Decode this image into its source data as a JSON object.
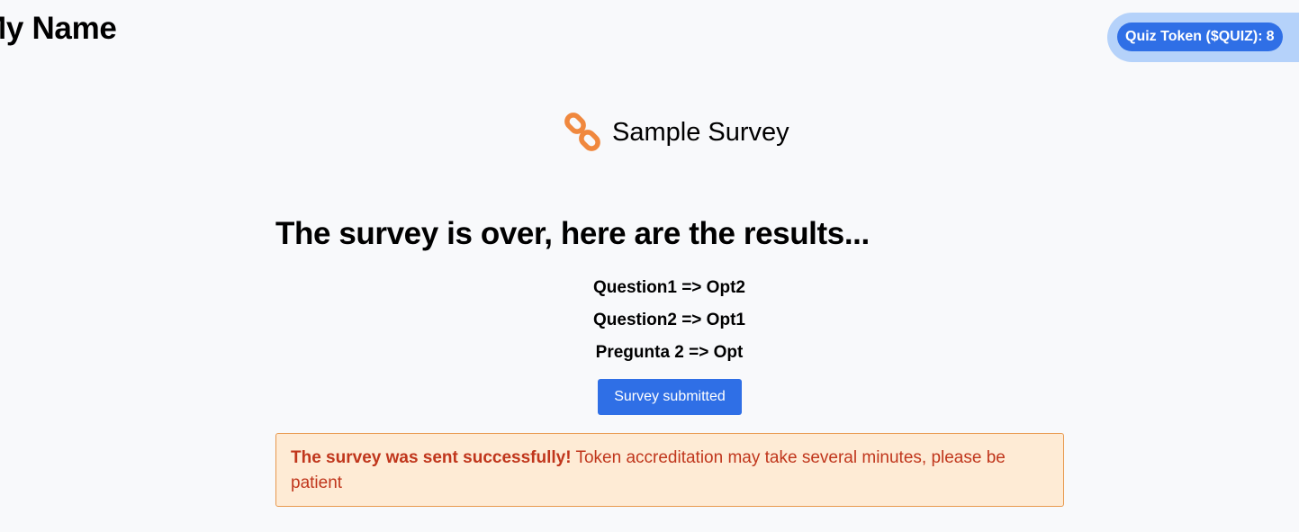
{
  "header": {
    "app_name": "My Name",
    "token_label": "Quiz Token ($QUIZ):",
    "token_balance": "8"
  },
  "survey": {
    "logo_icon": "chain-link-icon",
    "logo_color": "#f0883e",
    "title": "Sample Survey"
  },
  "results": {
    "heading": "The survey is over, here are the results...",
    "items": [
      {
        "text": "Question1 => Opt2"
      },
      {
        "text": "Question2 => Opt1"
      },
      {
        "text": "Pregunta 2 => Opt"
      }
    ],
    "submit_button_label": "Survey submitted"
  },
  "alert": {
    "strong_text": "The survey was sent successfully!",
    "message": " Token accreditation may take several minutes, please be patient"
  },
  "colors": {
    "primary": "#2f6fe6",
    "token_pill_bg": "#b5d2fa",
    "alert_bg": "#feebd5",
    "alert_border": "#e8994e",
    "alert_text": "#c0361c"
  }
}
